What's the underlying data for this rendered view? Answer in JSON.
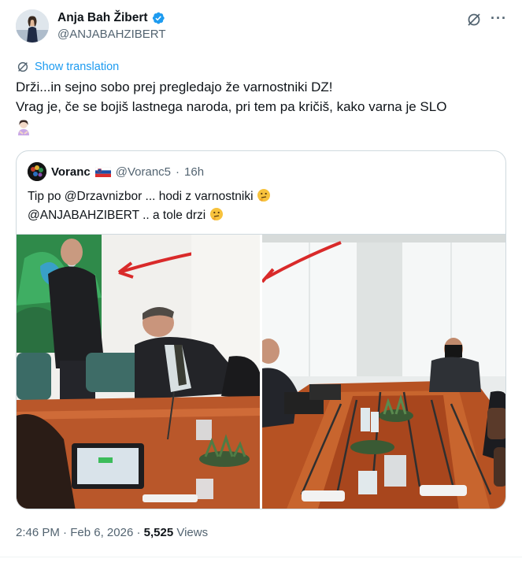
{
  "author": {
    "display_name": "Anja Bah Žibert",
    "handle": "@ANJABAHZIBERT",
    "verified": true
  },
  "icons": {
    "grok": "grok-icon",
    "more": "more-icon",
    "translate": "translate-icon",
    "verified": "verified-badge-icon"
  },
  "colors": {
    "link": "#1d9bf0",
    "muted": "#536471",
    "text": "#0f1419",
    "border": "#cfd9de"
  },
  "translate_label": "Show translation",
  "tweet": {
    "line1": "Drži...in sejno sobo prej pregledajo že varnostniki DZ!",
    "line2": "Vrag je, če se bojiš lastnega naroda, pri tem pa kričiš, kako varna je SLO"
  },
  "quote": {
    "name": "Voranc",
    "handle": "@Voranc5",
    "separator": "·",
    "time": "16h",
    "line1": "Tip po @Drzavnizbor ... hodi z varnostniki",
    "line2": "@ANJABAHZIBERT .. a tole drzi"
  },
  "footer": {
    "time": "2:46 PM",
    "separator": "·",
    "date": "Feb 6, 2026",
    "separator2": "·",
    "views_count": "5,525",
    "views_label": "Views"
  }
}
